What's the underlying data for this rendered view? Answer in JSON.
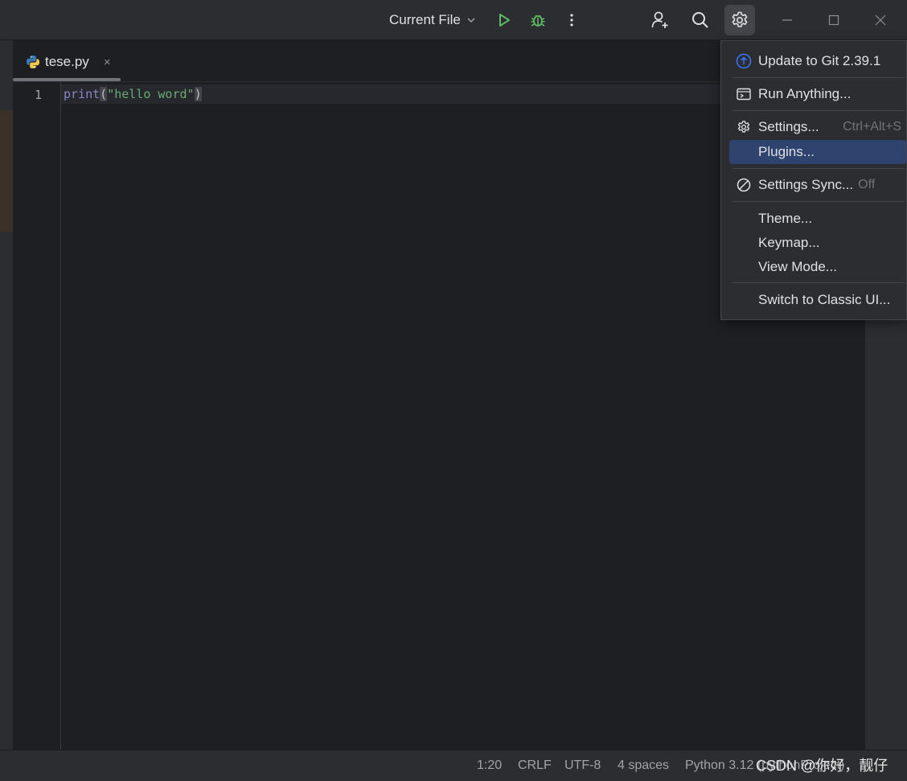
{
  "titlebar": {
    "run_config_label": "Current File"
  },
  "editor": {
    "tab": {
      "filename": "tese.py",
      "close_glyph": "×"
    },
    "line_number": "1",
    "code": {
      "fn": "print",
      "open": "(",
      "str": "\"hello word\"",
      "close": ")"
    }
  },
  "menu": {
    "update": "Update to Git 2.39.1",
    "run_anything": "Run Anything...",
    "settings": "Settings...",
    "settings_shortcut": "Ctrl+Alt+S",
    "plugins": "Plugins...",
    "settings_sync": "Settings Sync...",
    "settings_sync_state": "Off",
    "theme": "Theme...",
    "keymap": "Keymap...",
    "view_mode": "View Mode...",
    "switch_ui": "Switch to Classic UI..."
  },
  "statusbar": {
    "position": "1:20",
    "line_sep": "CRLF",
    "encoding": "UTF-8",
    "indent": "4 spaces",
    "interpreter": "Python 3.12 (pythonProject)"
  },
  "watermark": "CSDN @你好，靓仔",
  "colors": {
    "accent_blue": "#3574f0",
    "run_green": "#5fb865",
    "selection": "#2e436e"
  }
}
